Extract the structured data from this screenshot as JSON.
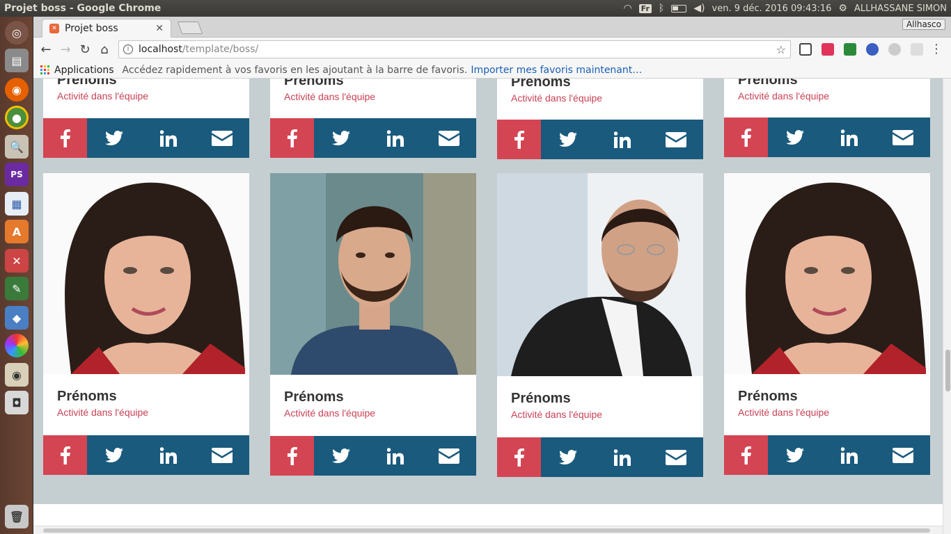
{
  "os": {
    "window_title": "Projet boss - Google Chrome",
    "keyboard_layout": "Fr",
    "datetime": "ven.  9 déc. 2016 09:43:16",
    "user": "ALLHASSANE SIMON"
  },
  "browser": {
    "tab_title": "Projet boss",
    "profile_label": "Allhasco",
    "url_host": "localhost",
    "url_path": "/template/boss/",
    "bookmarks_apps": "Applications",
    "bookmarks_hint": "Accédez rapidement à vos favoris en les ajoutant à la barre de favoris.",
    "bookmarks_link": "Importer mes favoris maintenant…"
  },
  "team": {
    "top_row": [
      {
        "name": "Prénoms",
        "role": "Activité dans l'équipe"
      },
      {
        "name": "Prénoms",
        "role": "Activité dans l'équipe"
      },
      {
        "name": "Prénoms",
        "role": "Activité dans l'équipe"
      },
      {
        "name": "Prénoms",
        "role": "Activité dans l'équipe"
      }
    ],
    "bottom_row": [
      {
        "name": "Prénoms",
        "role": "Activité dans l'équipe"
      },
      {
        "name": "Prénoms",
        "role": "Activité dans l'équipe"
      },
      {
        "name": "Prénoms",
        "role": "Activité dans l'équipe"
      },
      {
        "name": "Prénoms",
        "role": "Activité dans l'équipe"
      }
    ],
    "social_icons": [
      "facebook-icon",
      "twitter-icon",
      "linkedin-icon",
      "mail-icon"
    ]
  },
  "colors": {
    "facebook_red": "#d44553",
    "social_blue": "#195a7d",
    "role_red": "#c84055",
    "page_bg": "#c5ced1"
  }
}
